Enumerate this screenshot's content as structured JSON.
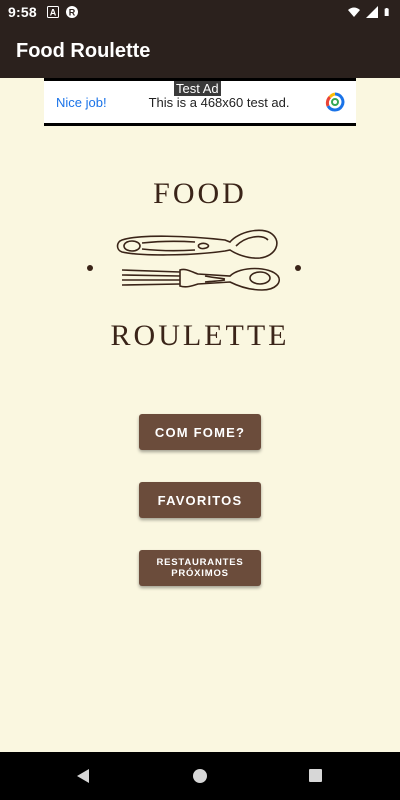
{
  "status_bar": {
    "time": "9:58",
    "icons_left": [
      "a-icon",
      "app-r-icon"
    ],
    "icons_right": [
      "wifi-icon",
      "signal-icon",
      "battery-icon"
    ]
  },
  "app_bar": {
    "title": "Food Roulette"
  },
  "ad": {
    "label": "Test Ad",
    "cta": "Nice job!",
    "text": "This is a 468x60 test ad."
  },
  "logo": {
    "line1": "FOOD",
    "line2": "ROULETTE"
  },
  "buttons": {
    "com_fome": "COM FOME?",
    "favoritos": "FAVORITOS",
    "restaurantes": "RESTAURANTES PRÓXIMOS"
  },
  "colors": {
    "background": "#faf7e0",
    "app_bar": "#2b211d",
    "button": "#6b4c3b",
    "logo_ink": "#3a2418"
  }
}
